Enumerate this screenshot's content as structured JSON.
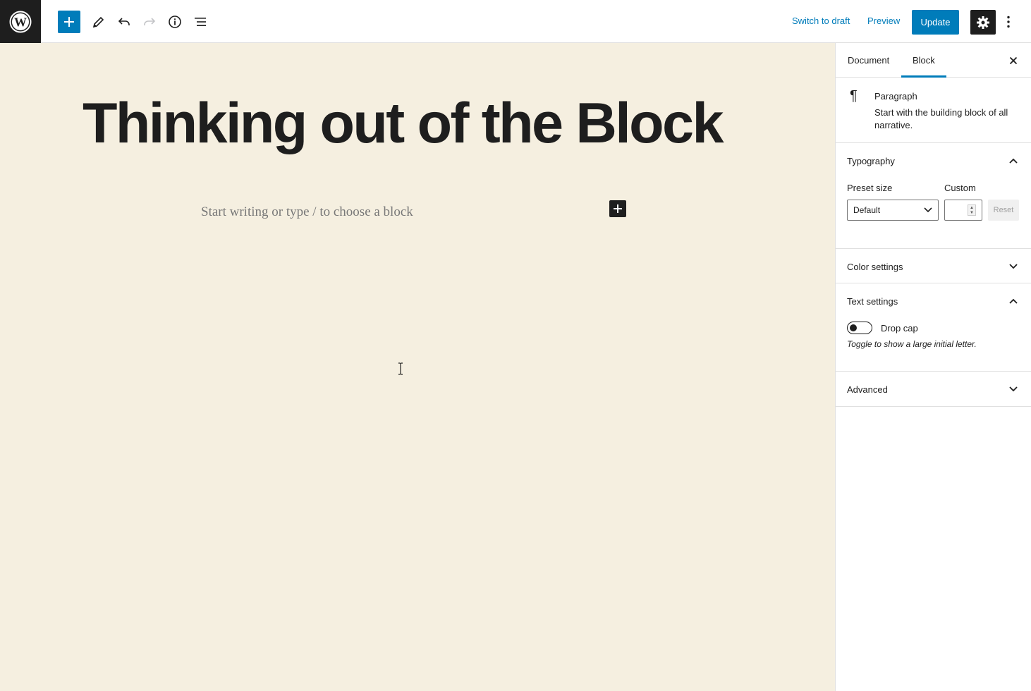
{
  "toolbar": {
    "logo_icon": "wordpress-icon",
    "add_block_icon": "plus-icon",
    "tools_icon": "pencil-icon",
    "undo_icon": "undo-icon",
    "redo_icon": "redo-icon",
    "info_icon": "info-icon",
    "outline_icon": "list-view-icon",
    "switch_to_draft": "Switch to draft",
    "preview": "Preview",
    "update": "Update",
    "settings_icon": "gear-icon",
    "more_icon": "more-vertical-icon",
    "accent_color": "#007cba"
  },
  "editor": {
    "title": "Thinking out of the Block",
    "placeholder": "Start writing or type / to choose a block",
    "background_color": "#f5efe0"
  },
  "sidebar": {
    "tabs": [
      {
        "label": "Document",
        "active": false
      },
      {
        "label": "Block",
        "active": true
      }
    ],
    "block_card": {
      "icon": "paragraph-icon",
      "title": "Paragraph",
      "description": "Start with the building block of all narrative."
    },
    "typography": {
      "heading": "Typography",
      "expanded": true,
      "preset_label": "Preset size",
      "preset_value": "Default",
      "custom_label": "Custom",
      "custom_value": "",
      "reset": "Reset"
    },
    "color_settings": {
      "heading": "Color settings",
      "expanded": false
    },
    "text_settings": {
      "heading": "Text settings",
      "expanded": true,
      "drop_cap_label": "Drop cap",
      "drop_cap_on": false,
      "help": "Toggle to show a large initial letter."
    },
    "advanced": {
      "heading": "Advanced",
      "expanded": false
    }
  }
}
